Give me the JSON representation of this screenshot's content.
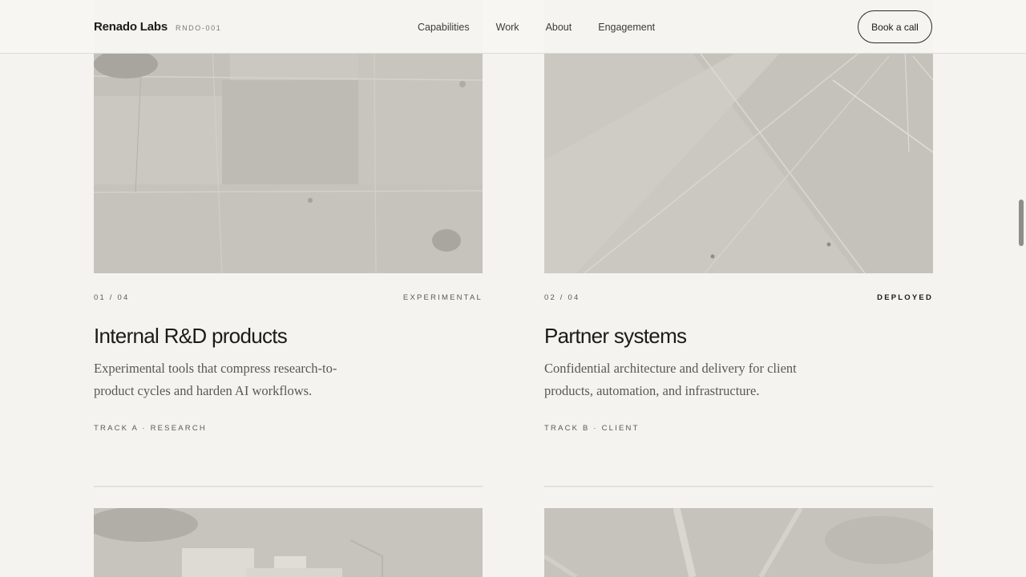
{
  "header": {
    "brand_name": "Renado Labs",
    "brand_code": "RNDO-001",
    "nav": [
      "Capabilities",
      "Work",
      "About",
      "Engagement"
    ],
    "cta_label": "Book a call"
  },
  "cards": [
    {
      "index": "01 / 04",
      "status": "EXPERIMENTAL",
      "title": "Internal R&D products",
      "description": "Experimental tools that compress research-to-product cycles and harden AI workflows.",
      "track": "TRACK A · RESEARCH"
    },
    {
      "index": "02 / 04",
      "status": "DEPLOYED",
      "title": "Partner systems",
      "description": "Confidential architecture and delivery for client products, automation, and infrastructure.",
      "track": "TRACK B · CLIENT"
    }
  ],
  "colors": {
    "background": "#f4f3ef",
    "text": "#1c1b18",
    "muted": "#5d5a53",
    "image_tone": "#c9c6bf"
  }
}
